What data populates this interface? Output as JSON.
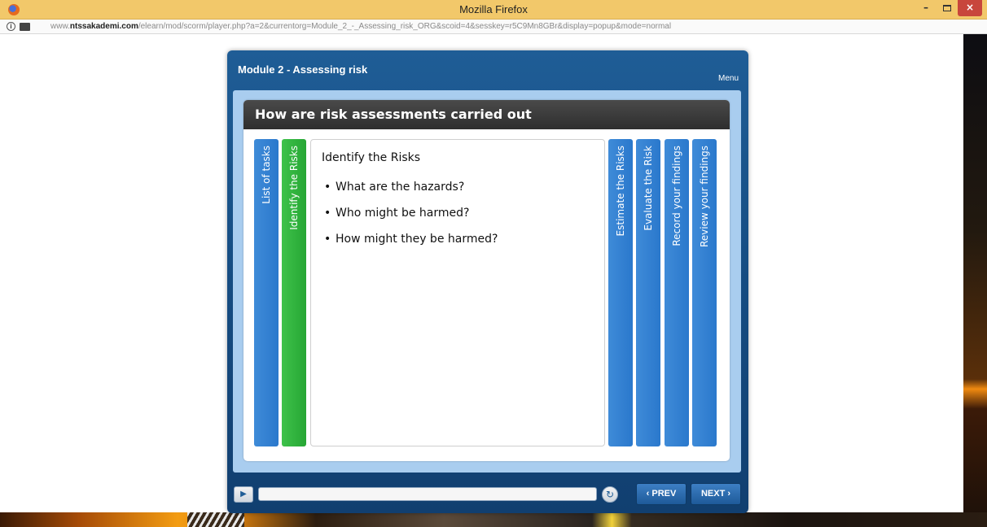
{
  "window": {
    "title": "Mozilla Firefox",
    "minimize": "–",
    "close": "×"
  },
  "urlbar": {
    "info_glyph": "i",
    "url_prefix": "www.",
    "url_domain": "ntssakademi.com",
    "url_path": "/elearn/mod/scorm/player.php?a=2&currentorg=Module_2_-_Assessing_risk_ORG&scoid=4&sesskey=r5C9Mn8GBr&display=popup&mode=normal"
  },
  "player": {
    "module_title": "Module 2 - Assessing risk",
    "menu_label": "Menu",
    "card_title": "How are risk assessments carried out",
    "left_tabs": [
      {
        "label": "List of tasks",
        "active": false
      },
      {
        "label": "Identify the Risks",
        "active": true
      }
    ],
    "right_tabs": [
      {
        "label": "Estimate the Risks",
        "active": false
      },
      {
        "label": "Evaluate the Risk",
        "active": false
      },
      {
        "label": "Record your findings",
        "active": false
      },
      {
        "label": "Review your findings",
        "active": false
      }
    ],
    "panel": {
      "heading": "Identify the Risks",
      "bullets": [
        "What are the hazards?",
        "Who might be harmed?",
        "How might they be harmed?"
      ]
    },
    "controls": {
      "play_glyph": "▶",
      "reload_glyph": "↻",
      "prev_label": "‹ PREV",
      "next_label": "NEXT ›",
      "progress": 0.0
    }
  },
  "colors": {
    "titlebar": "#f2c86a",
    "player_blue": "#1f5d96",
    "tab_blue": "#2a78cc",
    "tab_active_green": "#26a634"
  }
}
